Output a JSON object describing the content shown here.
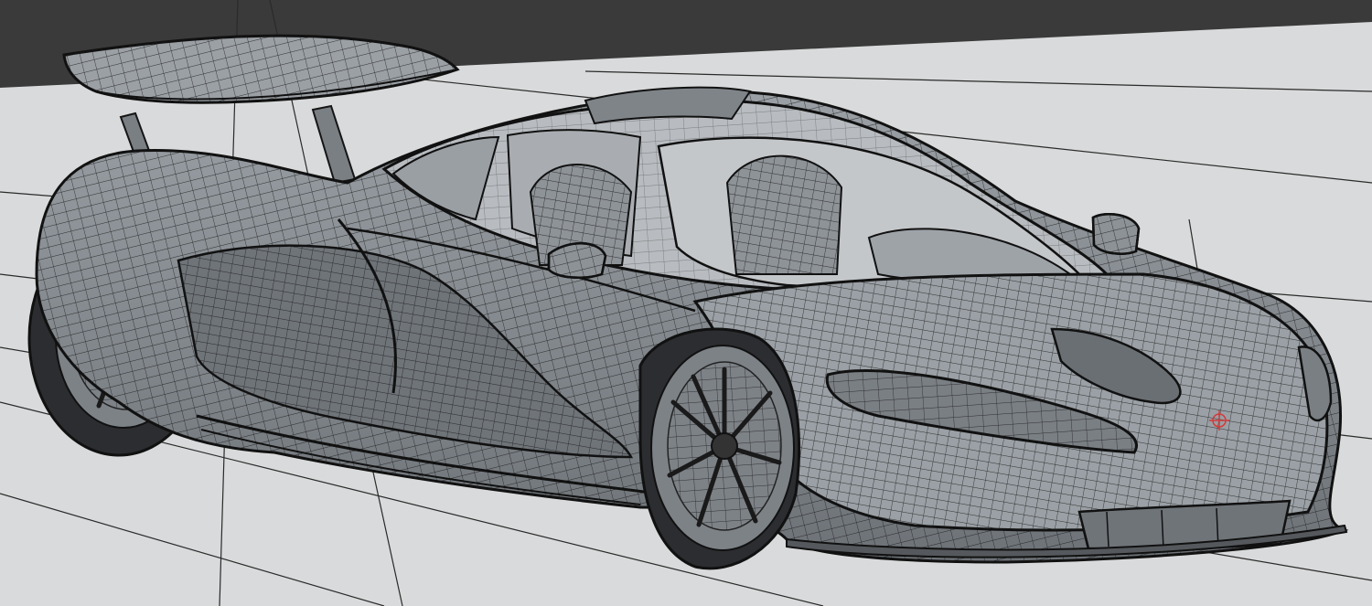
{
  "viewport": {
    "background_color": "#3a3a3a",
    "ground_color": "#d9dadb",
    "grid_line_color": "#2a2a2a",
    "surface_color": "#8c9196",
    "surface_shade_color": "#6e7378",
    "wire_color": "#1c1c1c",
    "pivot_marker_color": "#d23a3a",
    "grid_visible": true
  },
  "scene": {
    "object": "sports-car-mesh",
    "display_mode": "wireframe-on-shaded",
    "icons": [
      "pivot-marker-icon"
    ]
  }
}
